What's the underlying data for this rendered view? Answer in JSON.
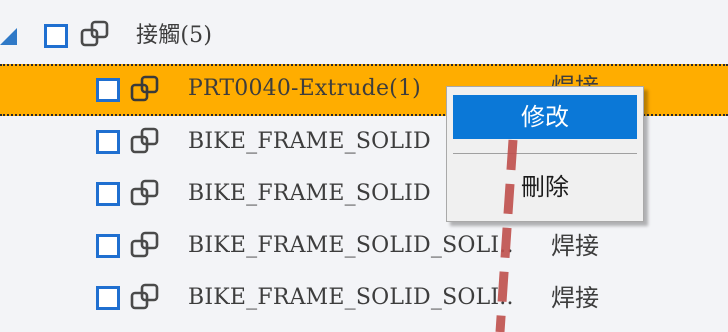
{
  "tree": {
    "parent": {
      "label": "接觸(5)",
      "icon": "linked-parts-icon"
    },
    "items": [
      {
        "label": "PRT0040-Extrude(1)",
        "type": "焊接",
        "selected": true
      },
      {
        "label": "BIKE_FRAME_SOLID",
        "type": ""
      },
      {
        "label": "BIKE_FRAME_SOLID",
        "type": ""
      },
      {
        "label": "BIKE_FRAME_SOLID_SOLI..",
        "type": "焊接"
      },
      {
        "label": "BIKE_FRAME_SOLID_SOLI..",
        "type": "焊接"
      }
    ]
  },
  "context_menu": {
    "edit_label": "修改",
    "delete_label": "刪除"
  },
  "colors": {
    "selection": "#ffad00",
    "checkbox_border": "#1f6fd0",
    "menu_highlight": "#0b78d7",
    "annotation_dash": "#c0504d"
  }
}
